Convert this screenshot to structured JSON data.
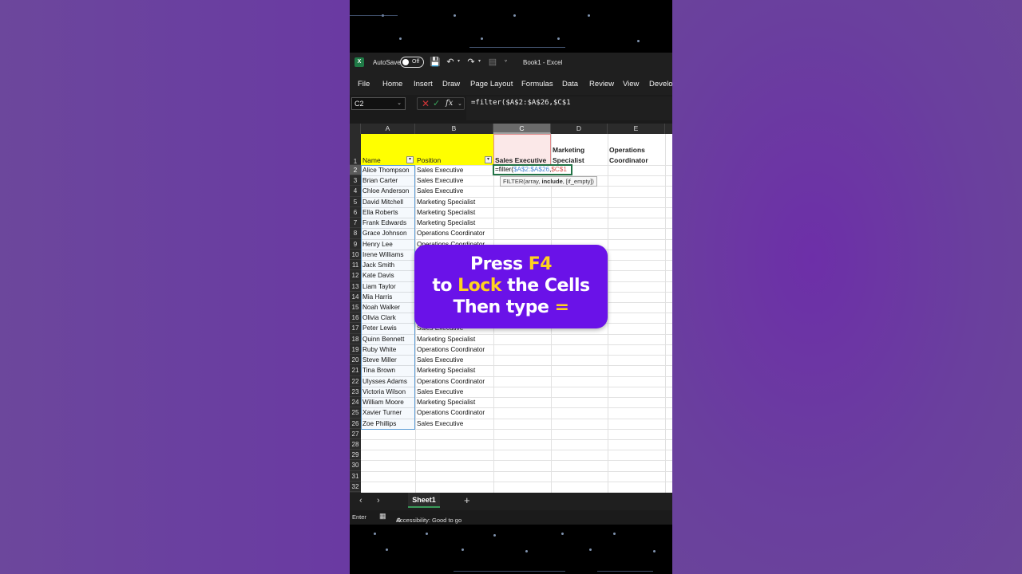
{
  "app": {
    "autosave_label": "AutoSave",
    "autosave_state": "Off",
    "doc_title": "Book1  -  Excel"
  },
  "menu": [
    "File",
    "Home",
    "Insert",
    "Draw",
    "Page Layout",
    "Formulas",
    "Data",
    "Review",
    "View",
    "Develo"
  ],
  "formula_bar": {
    "name_box": "C2",
    "formula": "=filter($A$2:$A$26,$C$1"
  },
  "columns": [
    "A",
    "B",
    "C",
    "D",
    "E"
  ],
  "row_numbers": [
    "1",
    "2",
    "3",
    "4",
    "5",
    "6",
    "7",
    "8",
    "9",
    "10",
    "11",
    "12",
    "13",
    "14",
    "15",
    "16",
    "17",
    "18",
    "19",
    "20",
    "21",
    "22",
    "23",
    "24",
    "25",
    "26",
    "27",
    "28",
    "29",
    "30",
    "31",
    "32"
  ],
  "headers": {
    "name": "Name",
    "position": "Position",
    "c1": "Sales Executive",
    "d1_line1": "Marketing",
    "d1_line2": "Specialist",
    "e1_line1": "Operations",
    "e1_line2": "Coordinator"
  },
  "rows": [
    {
      "name": "Alice Thompson",
      "position": "Sales Executive"
    },
    {
      "name": "Brian Carter",
      "position": "Sales Executive"
    },
    {
      "name": "Chloe Anderson",
      "position": "Sales Executive"
    },
    {
      "name": "David Mitchell",
      "position": "Marketing Specialist"
    },
    {
      "name": "Ella Roberts",
      "position": "Marketing Specialist"
    },
    {
      "name": "Frank Edwards",
      "position": "Marketing Specialist"
    },
    {
      "name": "Grace Johnson",
      "position": "Operations Coordinator"
    },
    {
      "name": "Henry Lee",
      "position": "Operations Coordinator"
    },
    {
      "name": "Irene Williams",
      "position": ""
    },
    {
      "name": "Jack Smith",
      "position": ""
    },
    {
      "name": "Kate Davis",
      "position": ""
    },
    {
      "name": "Liam Taylor",
      "position": ""
    },
    {
      "name": "Mia Harris",
      "position": ""
    },
    {
      "name": "Noah Walker",
      "position": ""
    },
    {
      "name": "Olivia Clark",
      "position": ""
    },
    {
      "name": "Peter Lewis",
      "position": "Sales Executive"
    },
    {
      "name": "Quinn Bennett",
      "position": "Marketing Specialist"
    },
    {
      "name": "Ruby White",
      "position": "Operations Coordinator"
    },
    {
      "name": "Steve Miller",
      "position": "Sales Executive"
    },
    {
      "name": "Tina Brown",
      "position": "Marketing Specialist"
    },
    {
      "name": "Ulysses Adams",
      "position": "Operations Coordinator"
    },
    {
      "name": "Victoria Wilson",
      "position": "Sales Executive"
    },
    {
      "name": "William Moore",
      "position": "Marketing Specialist"
    },
    {
      "name": "Xavier Turner",
      "position": "Operations Coordinator"
    },
    {
      "name": "Zoe Phillips",
      "position": "Sales Executive"
    }
  ],
  "edit_cell": {
    "prefix": "=filter(",
    "ref1": "$A$2:$A$26",
    "comma": ",",
    "ref2": "$C$1"
  },
  "tooltip": {
    "fn": "FILTER(array, ",
    "bold_arg": "include",
    "rest": ", [if_empty])"
  },
  "overlay": {
    "l1_a": "Press ",
    "l1_b": "F4",
    "l2_a": "to ",
    "l2_b": "Lock",
    "l2_c": " the Cells",
    "l3_a": "Then type ",
    "l3_b": "="
  },
  "sheet": {
    "tab": "Sheet1",
    "add": "+"
  },
  "status": {
    "mode": "Enter",
    "accessibility": "Accessibility: Good to go"
  },
  "colors": {
    "accent_green": "#217346",
    "overlay_purple": "#6a12e8",
    "highlight_yellow": "#ffd21f",
    "header_yellow": "#ffff00"
  }
}
